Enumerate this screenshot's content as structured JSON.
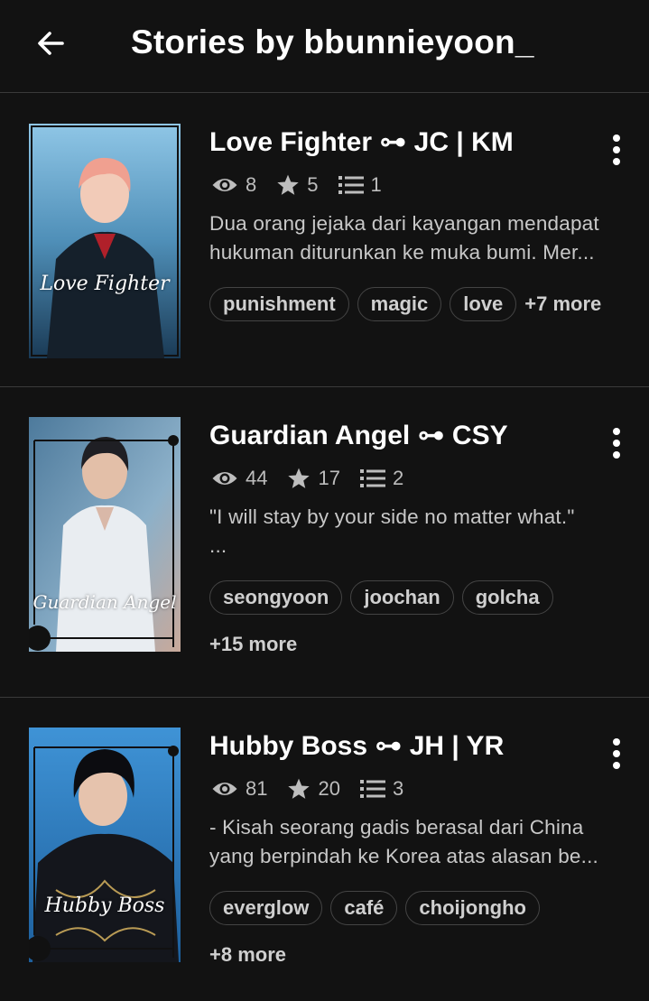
{
  "header": {
    "title": "Stories by bbunnieyoon_",
    "back_icon": "back-arrow-icon"
  },
  "stories": [
    {
      "title": "Love Fighter ⊶ JC | KM",
      "cover_text": "Love Fighter",
      "views": "8",
      "votes": "5",
      "parts": "1",
      "desc_line1": "Dua orang jejaka dari kayangan mendapat",
      "desc_line2": "hukuman diturunkan ke muka bumi. Mer...",
      "tags": [
        "punishment",
        "magic",
        "love"
      ],
      "more": "+7 more"
    },
    {
      "title": "Guardian Angel ⊶ CSY",
      "cover_text": "Guardian Angel",
      "views": "44",
      "votes": "17",
      "parts": "2",
      "desc_line1": "\"I will stay by your side no matter what.\"",
      "desc_line2": "...",
      "tags": [
        "seongyoon",
        "joochan",
        "golcha"
      ],
      "more": "+15 more"
    },
    {
      "title": "Hubby Boss ⊶ JH | YR",
      "cover_text": "Hubby Boss",
      "views": "81",
      "votes": "20",
      "parts": "3",
      "desc_line1": "- Kisah seorang gadis berasal dari China",
      "desc_line2": "yang berpindah ke Korea atas alasan be...",
      "tags": [
        "everglow",
        "café",
        "choijongho"
      ],
      "more": "+8 more"
    }
  ],
  "colors": {
    "background": "#121212",
    "divider": "#3a3a3a",
    "secondary_text": "#bdbdbd"
  }
}
